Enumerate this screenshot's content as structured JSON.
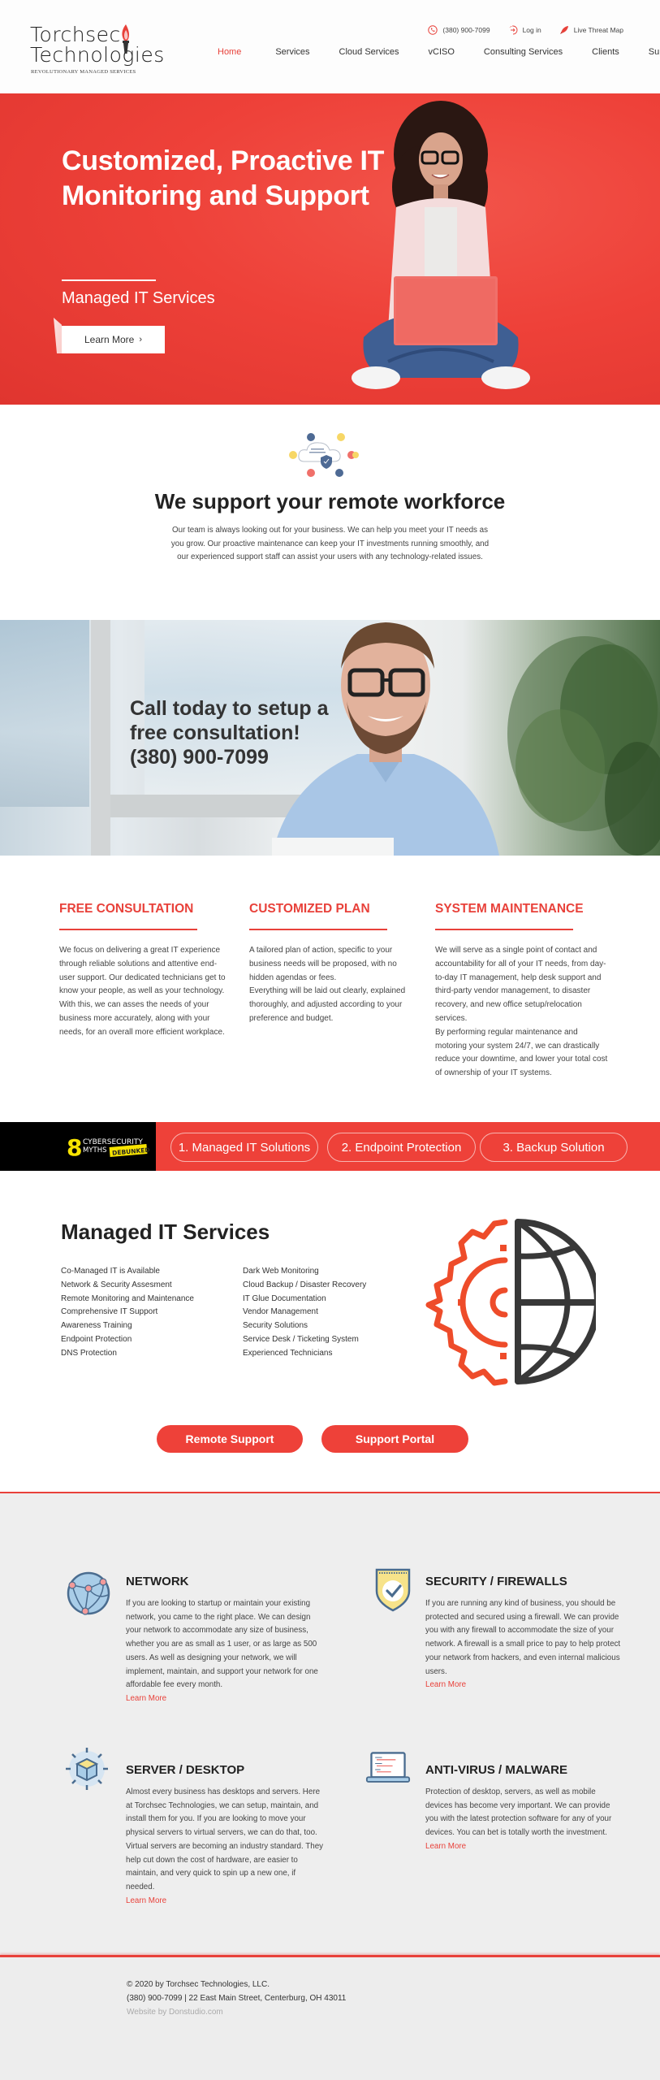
{
  "brand": {
    "name_line1": "Torchsec",
    "name_line2": "Technologies",
    "tagline": "REVOLUTIONARY MANAGED SERVICES",
    "accent": "#e8413a"
  },
  "topbar": {
    "phone": "(380) 900-7099",
    "login": "Log in",
    "threat_map": "Live Threat Map"
  },
  "nav": {
    "items": [
      {
        "label": "Home",
        "active": true
      },
      {
        "label": "Services",
        "active": false
      },
      {
        "label": "Cloud Services",
        "active": false
      },
      {
        "label": "vCISO",
        "active": false
      },
      {
        "label": "Consulting Services",
        "active": false
      },
      {
        "label": "Clients",
        "active": false
      },
      {
        "label": "Support",
        "active": false
      }
    ]
  },
  "hero": {
    "title": "Customized, Proactive IT Monitoring and Support",
    "subtitle": "Managed IT Services",
    "button": "Learn More",
    "button_icon": "chevron-right"
  },
  "remote": {
    "title": "We support your remote workforce",
    "text": "Our team is always looking out for your business. We can help you meet your IT needs as you grow. Our proactive maintenance can keep your IT investments running smoothly, and our experienced support staff can assist your users with any technology-related issues."
  },
  "consult_banner": {
    "line1": "Call today to setup a",
    "line2": "free consultation!",
    "line3": "(380) 900-7099"
  },
  "features": [
    {
      "title": "FREE CONSULTATION",
      "text": "We focus on delivering a great IT experience through reliable solutions and attentive end-user support. Our dedicated technicians get to know your people, as well as your technology.\nWith this, we can asses the needs of your business more accurately, along with your needs, for an overall more efficient workplace."
    },
    {
      "title": "CUSTOMIZED PLAN",
      "text": "A tailored plan of action, specific to your business needs will be proposed, with no hidden agendas or fees.\nEverything will be laid out clearly, explained thoroughly, and adjusted according to your preference and budget."
    },
    {
      "title": "SYSTEM MAINTENANCE",
      "text": "We will serve as a single point of contact and accountability for all of your IT needs, from day-to-day IT management, help desk support and third-party vendor management, to disaster recovery, and new office setup/relocation services.\nBy performing regular maintenance and motoring your system 24/7, we can drastically reduce your downtime, and lower your total cost of ownership of your IT systems."
    }
  ],
  "myths": {
    "badge_number": "8",
    "badge_line1": "CYBERSECURITY",
    "badge_line2": "MYTHS",
    "badge_tag": "DEBUNKED",
    "pills": [
      "1. Managed IT Solutions",
      "2. Endpoint Protection",
      "3. Backup Solution"
    ]
  },
  "managed": {
    "title": "Managed IT Services",
    "list_left": [
      "Co-Managed IT is Available",
      "Network & Security Assesment",
      "Remote Monitoring and Maintenance",
      "Comprehensive IT Support",
      "Awareness Training",
      "Endpoint Protection",
      "DNS Protection"
    ],
    "list_right": [
      "Dark Web Monitoring",
      "Cloud Backup / Disaster Recovery",
      "IT Glue Documentation",
      "Vendor Management",
      "Security Solutions",
      "Service Desk / Ticketing System",
      "Experienced Technicians"
    ],
    "btn_remote": "Remote Support",
    "btn_portal": "Support Portal"
  },
  "services": [
    {
      "icon": "network-globe-icon",
      "title": "NETWORK",
      "text": "If you are looking to startup or maintain your existing network, you came to the right place. We can design your network to accommodate any size of  business, whether you are as small as 1 user, or as large as 500 users. As well as designing your network, we will implement, maintain, and support your network for one affordable fee every month.",
      "link": "Learn More"
    },
    {
      "icon": "shield-check-icon",
      "title": "SECURITY / FIREWALLS",
      "text": "If you are running any kind of business, you should be protected and secured using a firewall. We can provide you with any firewall to accommodate the size of your network. A firewall is a small price to pay to help protect your network from hackers, and even internal malicious users.",
      "link": "Learn More"
    },
    {
      "icon": "server-cube-icon",
      "title": "SERVER / DESKTOP",
      "text": "Almost every business has desktops and servers. Here at Torchsec Technologies, we can setup, maintain, and install them for you. If you are looking to move your physical servers to virtual servers, we can do that, too. Virtual servers are becoming an industry standard. They help cut down the cost of hardware, are easier to maintain, and very quick to spin up a new one, if needed.",
      "link": "Learn More"
    },
    {
      "icon": "laptop-icon",
      "title": "ANTI-VIRUS / MALWARE",
      "text": "Protection of desktop, servers, as well as mobile devices has become very important. We can provide you with the latest protection software for any of your devices. You can bet is totally worth the investment.",
      "link": "Learn More"
    }
  ],
  "footer": {
    "copyright": "© 2020 by Torchsec Technologies, LLC.",
    "contact": "(380) 900-7099 | 22 East Main Street, Centerburg, OH 43011",
    "credit": "Website by Donstudio.com"
  }
}
